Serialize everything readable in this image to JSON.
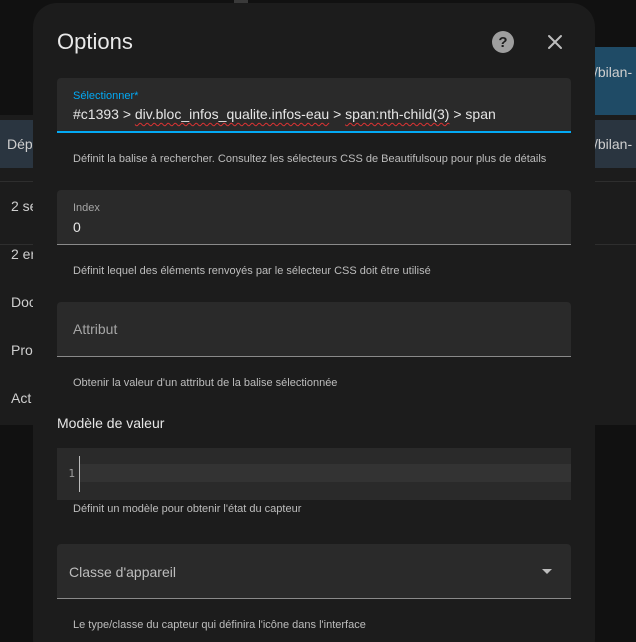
{
  "background": {
    "path_fragment_1": "/bilan-",
    "path_fragment_2": "/bilan-",
    "header_cell": "Dép",
    "rows": [
      "2 se",
      "2 er",
      "Doc",
      "Pro",
      "Act"
    ]
  },
  "dialog": {
    "title": "Options",
    "help_symbol": "?",
    "close_symbol": "✕"
  },
  "selector": {
    "label": "Sélectionner*",
    "value_prefix": "#c1393 > ",
    "value_misspelled": "div.bloc_infos_qualite.infos-eau",
    "value_mid": " > ",
    "value_misspelled_2": "span:nth-child(3)",
    "value_suffix": " > span",
    "helper": "Définit la balise à rechercher. Consultez les sélecteurs CSS de Beautifulsoup pour plus de détails"
  },
  "index": {
    "label": "Index",
    "value": "0",
    "helper": "Définit lequel des éléments renvoyés par le sélecteur CSS doit être utilisé"
  },
  "attribute": {
    "placeholder": "Attribut",
    "helper": "Obtenir la valeur d'un attribut de la balise sélectionnée"
  },
  "value_template": {
    "title": "Modèle de valeur",
    "line_number": "1",
    "helper": "Définit un modèle pour obtenir l'état du capteur"
  },
  "device_class": {
    "placeholder": "Classe d'appareil",
    "helper": "Le type/classe du capteur qui définira l'icône dans l'interface"
  },
  "colors": {
    "accent": "#03a9f4",
    "dialog_bg": "#1c1c1c",
    "field_bg": "#2a2a2a"
  }
}
